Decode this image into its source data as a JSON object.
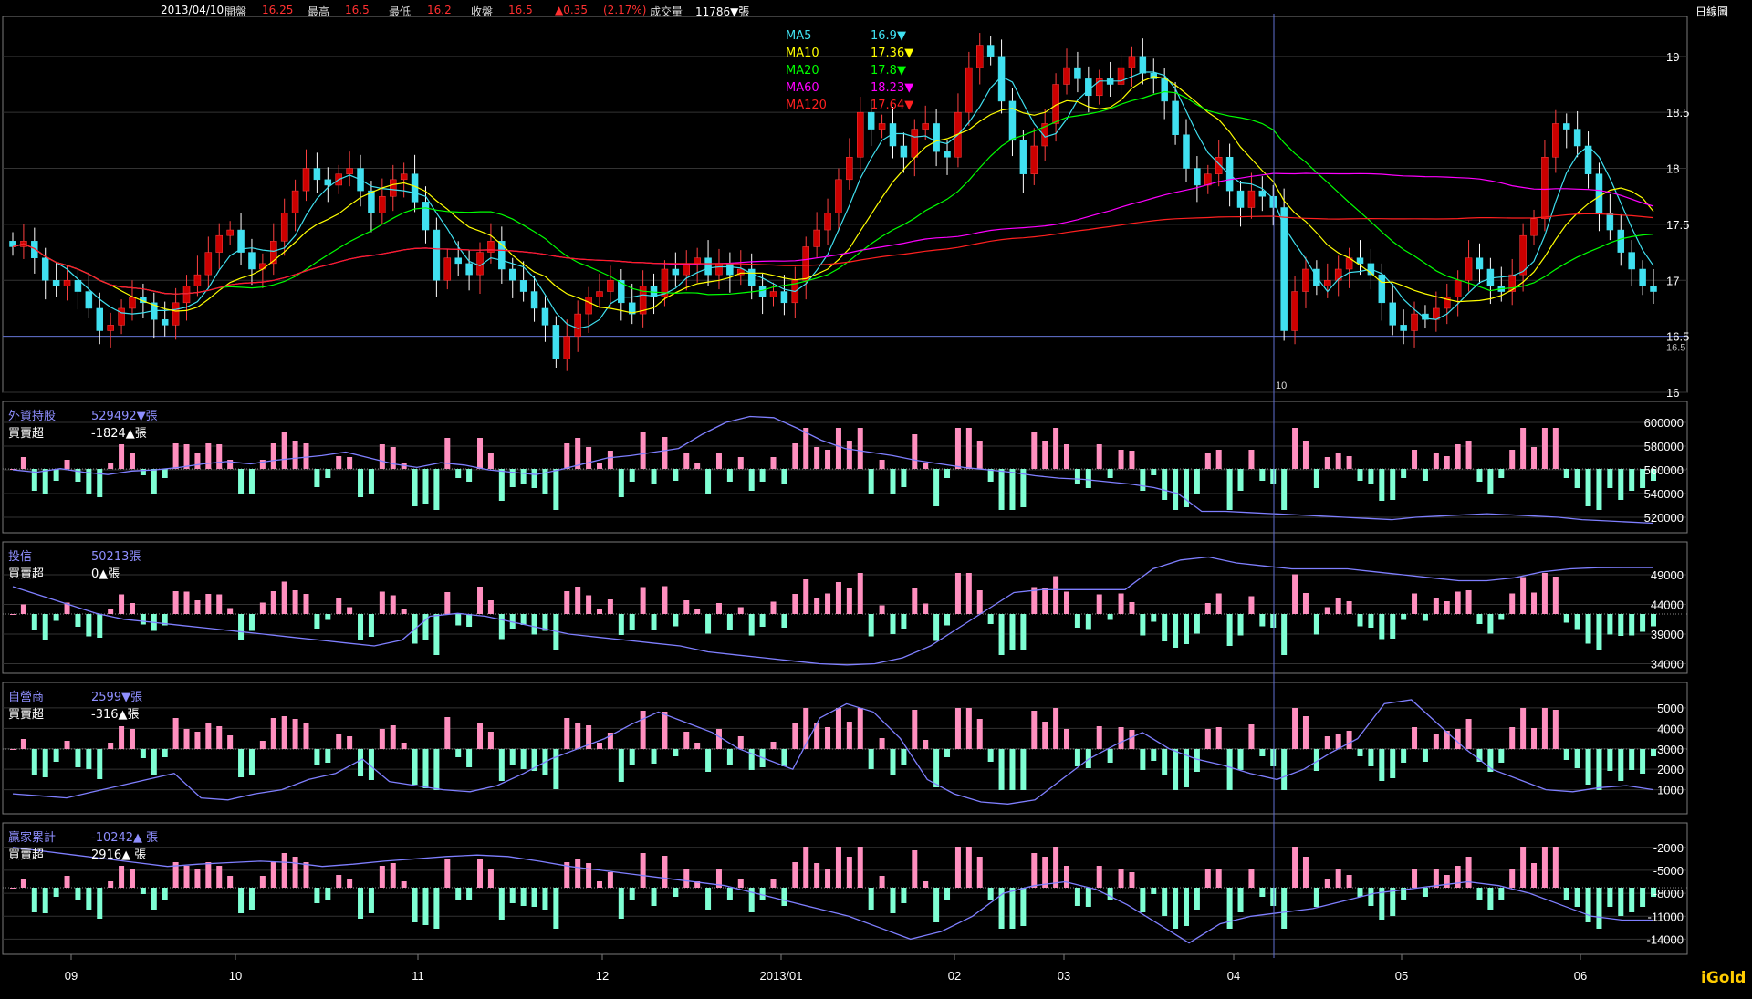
{
  "header": {
    "date": "2013/04/10",
    "open_label": "開盤",
    "open": "16.25",
    "high_label": "最高",
    "high": "16.5",
    "low_label": "最低",
    "low": "16.2",
    "close_label": "收盤",
    "close": "16.5",
    "change": "▲0.35",
    "change_pct": "(2.17%)",
    "volume_label": "成交量",
    "volume": "11786▼張",
    "period": "日線圖"
  },
  "brand": "iGold",
  "colors": {
    "up": "#ff8fbf",
    "down": "#7fffd4",
    "up_candle": "#cc0000",
    "down_candle": "#40e0f0",
    "grid": "#333333",
    "frame": "#7a7a7a",
    "line": "#7f7fff",
    "ma5": "#40e0f0",
    "ma10": "#ffff00",
    "ma20": "#00ff00",
    "ma60": "#ff00ff",
    "ma120": "#ff2020"
  },
  "main": {
    "legend": [
      {
        "name": "MA5",
        "value": "16.9▼",
        "color": "#40e0f0"
      },
      {
        "name": "MA10",
        "value": "17.36▼",
        "color": "#ffff00"
      },
      {
        "name": "MA20",
        "value": "17.8▼",
        "color": "#00ff00"
      },
      {
        "name": "MA60",
        "value": "18.23▼",
        "color": "#ff00ff"
      },
      {
        "name": "MA120",
        "value": "17.64▼",
        "color": "#ff2020"
      }
    ],
    "yticks": [
      "19",
      "18.5",
      "18",
      "17.5",
      "17",
      "16.5",
      "16"
    ],
    "ref_label": "16.5",
    "cursor_label": "10"
  },
  "panels": [
    {
      "title": "外資持股",
      "value": "529492▼張",
      "sub_label": "買賣超",
      "sub_value": "-1824▲張",
      "yticks": [
        "600000",
        "580000",
        "560000",
        "540000",
        "520000"
      ]
    },
    {
      "title": "投信",
      "value": "50213張",
      "sub_label": "買賣超",
      "sub_value": "0▲張",
      "yticks": [
        "49000",
        "44000",
        "39000",
        "34000"
      ]
    },
    {
      "title": "自營商",
      "value": "2599▼張",
      "sub_label": "買賣超",
      "sub_value": "-316▲張",
      "yticks": [
        "5000",
        "4000",
        "3000",
        "2000",
        "1000"
      ]
    },
    {
      "title": "贏家累計",
      "value": "-10242▲ 張",
      "sub_label": "買賣超",
      "sub_value": "2916▲ 張",
      "yticks": [
        "-2000",
        "-5000",
        "-8000",
        "-11000",
        "-14000"
      ]
    }
  ],
  "xaxis": [
    "09",
    "10",
    "11",
    "12",
    "2013/01",
    "02",
    "03",
    "04",
    "05",
    "06"
  ],
  "chart_data": {
    "type": "candlestick",
    "period": "daily",
    "x_ticks": [
      "09",
      "10",
      "11",
      "12",
      "2013/01",
      "02",
      "03",
      "04",
      "05",
      "06"
    ],
    "price_ylim": [
      16,
      19.3
    ],
    "selected_bar": {
      "date": "2013/04/10",
      "open": 16.25,
      "high": 16.5,
      "low": 16.2,
      "close": 16.5,
      "change": 0.35,
      "change_pct": 2.17,
      "volume": 11786
    },
    "price_close": [
      17.3,
      17.35,
      17.2,
      17.0,
      16.95,
      17.0,
      16.9,
      16.75,
      16.55,
      16.6,
      16.75,
      16.85,
      16.8,
      16.65,
      16.6,
      16.8,
      16.95,
      17.05,
      17.25,
      17.4,
      17.45,
      17.25,
      17.1,
      17.15,
      17.35,
      17.6,
      17.8,
      18.0,
      17.9,
      17.85,
      17.95,
      18.0,
      17.8,
      17.6,
      17.75,
      17.9,
      17.95,
      17.7,
      17.45,
      17.0,
      17.2,
      17.15,
      17.05,
      17.25,
      17.35,
      17.1,
      17.0,
      16.9,
      16.75,
      16.6,
      16.3,
      16.5,
      16.7,
      16.85,
      16.9,
      17.0,
      16.8,
      16.7,
      16.95,
      16.85,
      17.1,
      17.05,
      17.15,
      17.2,
      17.05,
      17.15,
      17.05,
      17.1,
      16.95,
      16.85,
      16.9,
      16.8,
      17.0,
      17.3,
      17.45,
      17.6,
      17.9,
      18.1,
      18.5,
      18.35,
      18.4,
      18.2,
      18.1,
      18.35,
      18.4,
      18.15,
      18.1,
      18.5,
      18.9,
      19.1,
      19.0,
      18.6,
      18.25,
      17.95,
      18.2,
      18.4,
      18.75,
      18.9,
      18.8,
      18.65,
      18.8,
      18.75,
      18.9,
      19.0,
      18.85,
      18.8,
      18.6,
      18.3,
      18.0,
      17.85,
      17.95,
      18.1,
      17.8,
      17.65,
      17.8,
      17.75,
      17.65,
      16.55,
      16.9,
      17.1,
      16.95,
      17.0,
      17.1,
      17.2,
      17.15,
      17.05,
      16.8,
      16.6,
      16.55,
      16.7,
      16.65,
      16.75,
      16.85,
      17.0,
      17.2,
      17.1,
      16.95,
      16.9,
      17.05,
      17.4,
      17.55,
      18.1,
      18.4,
      18.35,
      18.2,
      17.95,
      17.6,
      17.45,
      17.25,
      17.1,
      16.95,
      16.9
    ],
    "ma_legend": {
      "MA5": 16.9,
      "MA10": 17.36,
      "MA20": 17.8,
      "MA60": 18.23,
      "MA120": 17.64
    },
    "foreign_holdings": {
      "ylim": [
        510000,
        610000
      ],
      "yticks": [
        600000,
        580000,
        560000,
        540000,
        520000
      ],
      "current": 529492,
      "net": -1824,
      "line": [
        560000,
        558000,
        561000,
        558000,
        556000,
        559000,
        560000,
        562000,
        565000,
        567000,
        565000,
        568000,
        570000,
        572000,
        575000,
        570000,
        565000,
        562000,
        566000,
        564000,
        560000,
        558000,
        556000,
        560000,
        565000,
        570000,
        572000,
        575000,
        578000,
        590000,
        600000,
        605000,
        604000,
        595000,
        585000,
        578000,
        575000,
        572000,
        568000,
        565000,
        562000,
        560000,
        558000,
        555000,
        553000,
        552000,
        550000,
        548000,
        545000,
        540000,
        525000,
        525000,
        524000,
        523000,
        522000,
        521000,
        520000,
        519000,
        518000,
        520000,
        521000,
        522000,
        523000,
        522000,
        521000,
        520000,
        518000,
        517000,
        516000,
        515000
      ]
    },
    "trust": {
      "ylim": [
        33000,
        53000
      ],
      "yticks": [
        49000,
        44000,
        39000,
        34000
      ],
      "current": 50213,
      "net": 0,
      "line": [
        47000,
        45500,
        44000,
        42500,
        41500,
        41000,
        40500,
        40000,
        39500,
        39000,
        38500,
        38000,
        37500,
        37000,
        38000,
        42000,
        42500,
        42000,
        41000,
        40000,
        39000,
        38500,
        38000,
        37500,
        37000,
        36000,
        35500,
        35000,
        34500,
        34000,
        33800,
        34000,
        35000,
        37000,
        40000,
        43000,
        46000,
        46500,
        46500,
        46500,
        46500,
        50000,
        51500,
        52000,
        51000,
        50500,
        50000,
        50000,
        50000,
        49500,
        49000,
        48500,
        48000,
        48000,
        48500,
        49500,
        50000,
        50200,
        50213,
        50213
      ]
    },
    "dealer": {
      "ylim": [
        0,
        5800
      ],
      "yticks": [
        5000,
        4000,
        3000,
        2000,
        1000
      ],
      "current": 2599,
      "net": -316,
      "line": [
        800,
        700,
        600,
        900,
        1200,
        1500,
        1800,
        600,
        500,
        800,
        1000,
        1500,
        1800,
        2500,
        1400,
        1200,
        1000,
        900,
        1200,
        1800,
        2500,
        3000,
        3500,
        4200,
        4800,
        4300,
        3800,
        3000,
        2500,
        2000,
        4500,
        5200,
        4800,
        3500,
        1500,
        800,
        400,
        300,
        500,
        1500,
        2500,
        3200,
        3800,
        3000,
        2500,
        2200,
        1800,
        1500,
        2000,
        2800,
        3500,
        5200,
        5400,
        4200,
        3000,
        2000,
        1500,
        1000,
        900,
        1100,
        1200,
        1000
      ]
    },
    "winner_cumulative": {
      "ylim": [
        -15500,
        0
      ],
      "yticks": [
        -2000,
        -5000,
        -8000,
        -11000,
        -14000
      ],
      "current": -10242,
      "net": 2916,
      "line": [
        -2000,
        -2500,
        -3000,
        -3500,
        -4000,
        -4500,
        -4200,
        -4000,
        -3800,
        -4000,
        -4500,
        -4200,
        -3800,
        -3500,
        -3200,
        -3000,
        -3200,
        -3800,
        -4500,
        -5000,
        -5500,
        -6000,
        -6500,
        -7000,
        -8000,
        -9000,
        -10000,
        -11000,
        -12500,
        -14000,
        -13000,
        -11000,
        -8000,
        -7000,
        -6500,
        -7500,
        -9500,
        -12000,
        -14500,
        -12000,
        -11000,
        -10500,
        -10000,
        -9000,
        -8000,
        -7500,
        -7000,
        -6500,
        -7000,
        -8000,
        -9500,
        -11000,
        -11500,
        -11500
      ]
    }
  }
}
